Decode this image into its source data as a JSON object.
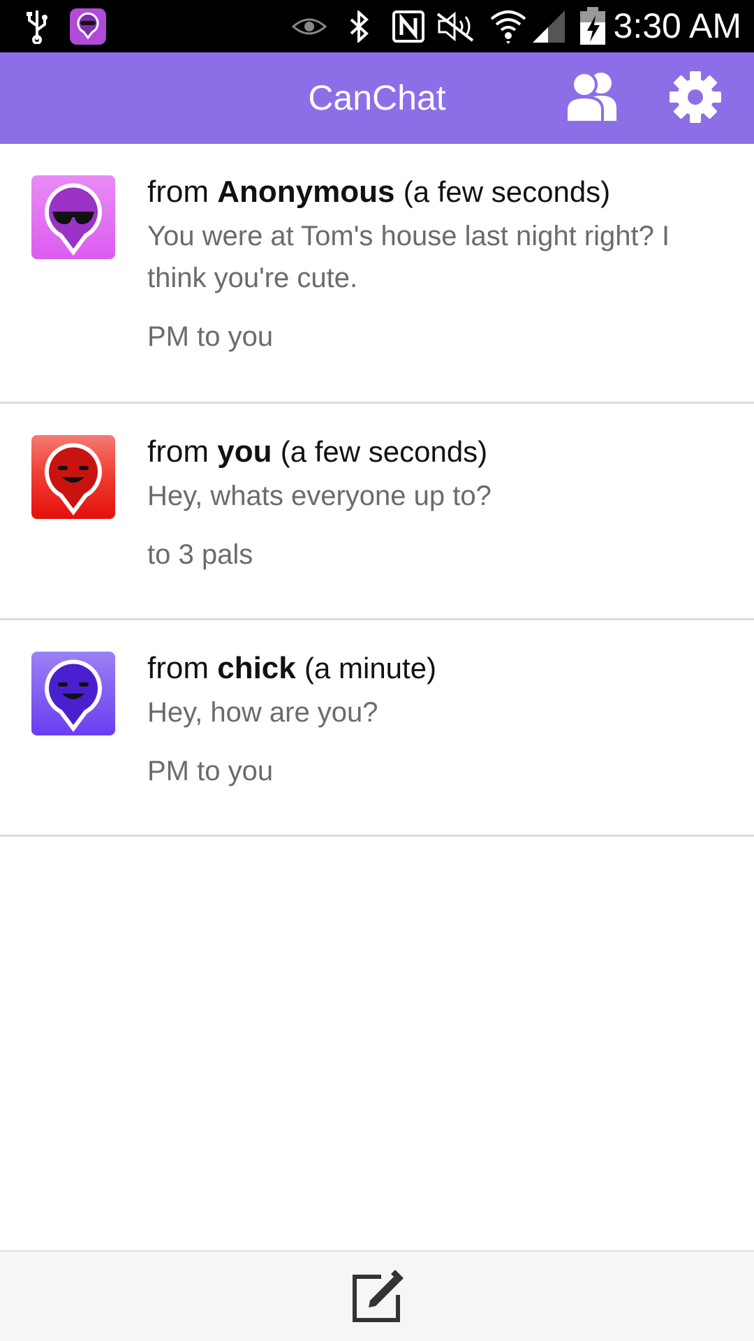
{
  "status_bar": {
    "time": "3:30 AM",
    "icons": [
      "usb-icon",
      "canchat-notification-icon",
      "eye-icon",
      "bluetooth-icon",
      "nfc-icon",
      "mute-icon",
      "wifi-icon",
      "signal-icon",
      "battery-charging-icon"
    ]
  },
  "app_bar": {
    "title": "CanChat",
    "actions": [
      "pals-icon",
      "settings-gear-icon"
    ],
    "color": "#8c6fe6"
  },
  "messages": [
    {
      "prefix": "from",
      "sender": "Anonymous",
      "time": "(a few seconds)",
      "text": "You were at Tom's house last night right? I think you're cute.",
      "meta": "PM to you",
      "avatar_color": "#e06cf0"
    },
    {
      "prefix": "from",
      "sender": "you",
      "time": "(a few seconds)",
      "text": "Hey, whats everyone up to?",
      "meta": "to 3 pals",
      "avatar_color": "#e8201c"
    },
    {
      "prefix": "from",
      "sender": "chick",
      "time": "(a minute)",
      "text": "Hey, how are you?",
      "meta": "PM to you",
      "avatar_color": "#7a4ff0"
    }
  ],
  "bottom_bar": {
    "action": "compose-icon"
  }
}
